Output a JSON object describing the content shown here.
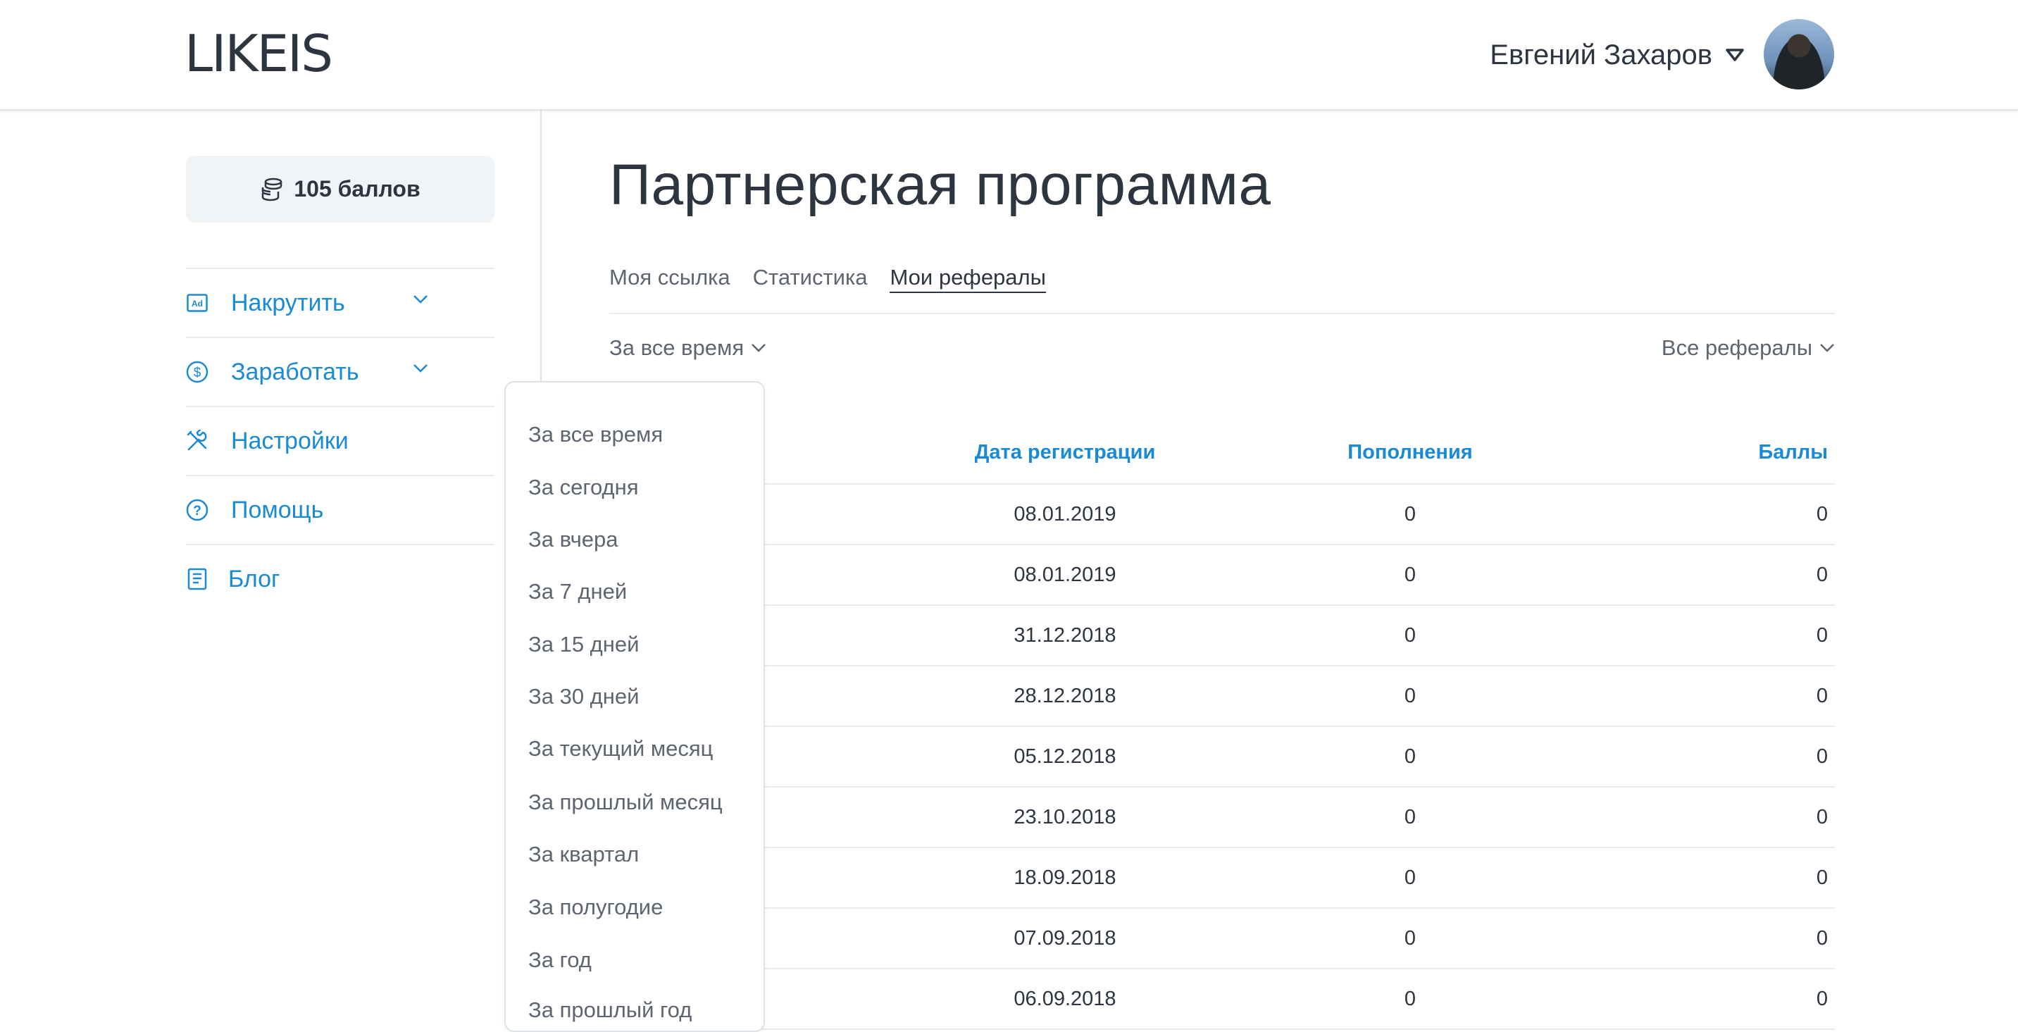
{
  "header": {
    "logo": "LIKEIS",
    "user_name": "Евгений Захаров"
  },
  "sidebar": {
    "points": "105 баллов",
    "items": [
      {
        "label": "Накрутить",
        "icon": "ad-icon",
        "has_chevron": true
      },
      {
        "label": "Заработать",
        "icon": "dollar-icon",
        "has_chevron": true
      },
      {
        "label": "Настройки",
        "icon": "tools-icon",
        "has_chevron": false
      },
      {
        "label": "Помощь",
        "icon": "question-icon",
        "has_chevron": false
      },
      {
        "label": "Блог",
        "icon": "book-icon",
        "has_chevron": false
      }
    ]
  },
  "main": {
    "title": "Партнерская программа",
    "tabs": [
      "Моя ссылка",
      "Статистика",
      "Мои рефералы"
    ],
    "active_tab": "Мои рефералы",
    "filter_period": "За все время",
    "filter_referrals": "Все рефералы",
    "table": {
      "headers": [
        "Дата регистрации",
        "Пополнения",
        "Баллы"
      ],
      "rows": [
        {
          "date": "08.01.2019",
          "deposits": "0",
          "points": "0"
        },
        {
          "date": "08.01.2019",
          "deposits": "0",
          "points": "0"
        },
        {
          "date": "31.12.2018",
          "deposits": "0",
          "points": "0"
        },
        {
          "date": "28.12.2018",
          "deposits": "0",
          "points": "0"
        },
        {
          "date": "05.12.2018",
          "deposits": "0",
          "points": "0"
        },
        {
          "date": "23.10.2018",
          "deposits": "0",
          "points": "0"
        },
        {
          "date": "18.09.2018",
          "deposits": "0",
          "points": "0"
        },
        {
          "date": "07.09.2018",
          "deposits": "0",
          "points": "0"
        },
        {
          "date": "06.09.2018",
          "deposits": "0",
          "points": "0"
        }
      ]
    }
  },
  "dropdown": {
    "options": [
      "За все время",
      "За сегодня",
      "За вчера",
      "За 7 дней",
      "За 15 дней",
      "За 30 дней",
      "За текущий месяц",
      "За прошлый месяц",
      "За квартал",
      "За полугодие",
      "За год",
      "За прошлый год"
    ]
  },
  "colors": {
    "accent": "#1a8ad4",
    "text": "#2d3540",
    "muted": "#5d6670",
    "divider": "#e8ebef"
  }
}
